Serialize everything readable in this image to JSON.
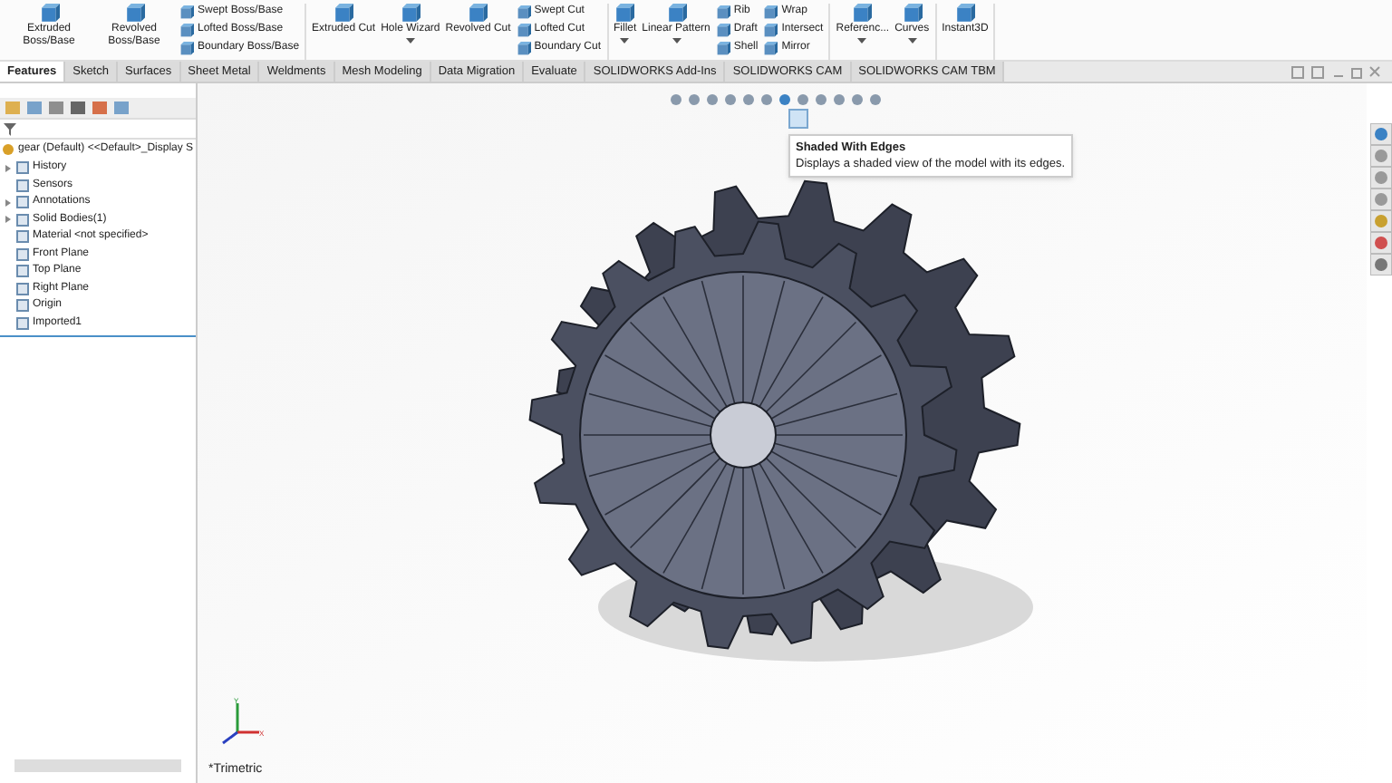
{
  "ribbon": {
    "groups": [
      {
        "large": [
          {
            "label": "Extruded Boss/Base",
            "dropdown": false
          },
          {
            "label": "Revolved Boss/Base",
            "dropdown": false
          }
        ],
        "small": [
          [
            "Swept Boss/Base",
            "Lofted Boss/Base",
            "Boundary Boss/Base"
          ]
        ]
      },
      {
        "large": [
          {
            "label": "Extruded Cut",
            "dropdown": false
          },
          {
            "label": "Hole Wizard",
            "dropdown": true
          },
          {
            "label": "Revolved Cut",
            "dropdown": false
          }
        ],
        "small": [
          [
            "Swept Cut",
            "Lofted Cut",
            "Boundary Cut"
          ]
        ]
      },
      {
        "large": [
          {
            "label": "Fillet",
            "dropdown": true
          },
          {
            "label": "Linear Pattern",
            "dropdown": true
          }
        ],
        "small": [
          [
            "Rib",
            "Draft",
            "Shell"
          ],
          [
            "Wrap",
            "Intersect",
            "Mirror"
          ]
        ]
      },
      {
        "large": [
          {
            "label": "Referenc...",
            "dropdown": true
          },
          {
            "label": "Curves",
            "dropdown": true
          }
        ]
      },
      {
        "large": [
          {
            "label": "Instant3D",
            "dropdown": false
          }
        ]
      }
    ]
  },
  "tabs": [
    {
      "label": "Features",
      "selected": true
    },
    {
      "label": "Sketch",
      "selected": false
    },
    {
      "label": "Surfaces",
      "selected": false
    },
    {
      "label": "Sheet Metal",
      "selected": false
    },
    {
      "label": "Weldments",
      "selected": false
    },
    {
      "label": "Mesh Modeling",
      "selected": false
    },
    {
      "label": "Data Migration",
      "selected": false
    },
    {
      "label": "Evaluate",
      "selected": false
    },
    {
      "label": "SOLIDWORKS Add-Ins",
      "selected": false
    },
    {
      "label": "SOLIDWORKS CAM",
      "selected": false
    },
    {
      "label": "SOLIDWORKS CAM TBM",
      "selected": false
    }
  ],
  "tree": {
    "root": "gear (Default) <<Default>_Display S",
    "items": [
      {
        "label": "History",
        "expandable": true
      },
      {
        "label": "Sensors",
        "expandable": false
      },
      {
        "label": "Annotations",
        "expandable": true
      },
      {
        "label": "Solid Bodies(1)",
        "expandable": true
      },
      {
        "label": "Material <not specified>",
        "expandable": false
      },
      {
        "label": "Front Plane",
        "expandable": false
      },
      {
        "label": "Top Plane",
        "expandable": false
      },
      {
        "label": "Right Plane",
        "expandable": false
      },
      {
        "label": "Origin",
        "expandable": false
      },
      {
        "label": "Imported1",
        "expandable": false
      }
    ]
  },
  "tooltip": {
    "title": "Shaded With Edges",
    "description": "Displays a shaded view of the model with its edges."
  },
  "viewport": {
    "view_name": "*Trimetric",
    "axis_x": "X",
    "axis_y": "Y"
  }
}
